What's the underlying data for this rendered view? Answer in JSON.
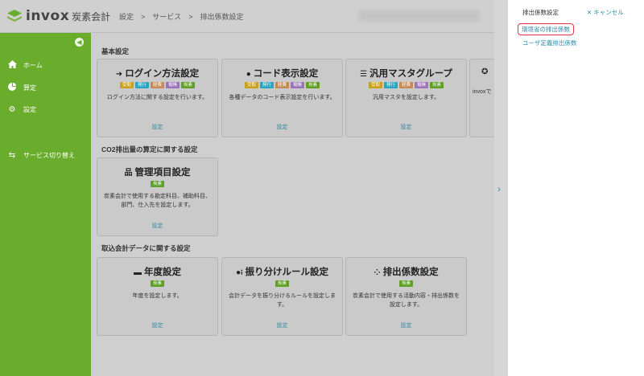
{
  "app": {
    "logo": "invox",
    "logo_sub": "炭素会計",
    "breadcrumb": "設定　>　サービス　>　排出係数設定"
  },
  "sidebar": {
    "items": [
      {
        "label": "ホーム",
        "icon": "home-icon"
      },
      {
        "label": "算定",
        "icon": "pie-chart-icon"
      },
      {
        "label": "設定",
        "icon": "gear-icon"
      },
      {
        "label": "サービス切り替え",
        "icon": "switch-icon"
      }
    ]
  },
  "sections": [
    {
      "title": "基本設定"
    },
    {
      "title": "CO2排出量の算定に関する設定"
    },
    {
      "title": "取込会計データに関する設定"
    }
  ],
  "cards": [
    {
      "icon": "sign-in-icon",
      "title": "ログイン方法設定",
      "tags": [
        "受取",
        "発行",
        "経費",
        "電帳",
        "炭素"
      ],
      "desc": "ログイン方法に関する設定を行います。",
      "link": "設定"
    },
    {
      "icon": "abc-icon",
      "title": "コード表示設定",
      "tags": [
        "受取",
        "発行",
        "経費",
        "電帳",
        "炭素"
      ],
      "desc": "各種データのコード表示設定を行います。",
      "link": "設定"
    },
    {
      "icon": "list-icon",
      "title": "汎用マスタグループ",
      "tags": [
        "受取",
        "発行",
        "経費",
        "電帳",
        "炭素"
      ],
      "desc": "汎用マスタを設定します。",
      "link": "設定"
    },
    {
      "icon": "star-icon",
      "title": "",
      "tags": [],
      "desc": "invoxで",
      "link": ""
    },
    {
      "icon": "sitemap-icon",
      "title": "管理項目設定",
      "tags": [
        "炭素"
      ],
      "desc": "炭素会計で使用する勘定科目、補助科目、部門、仕入先を設定します。",
      "link": "設定"
    },
    {
      "icon": "calendar-icon",
      "title": "年度設定",
      "tags": [
        "炭素"
      ],
      "desc": "年度を設定します。",
      "link": "設定"
    },
    {
      "icon": "rule-icon",
      "title": "振り分けルール設定",
      "tags": [
        "炭素"
      ],
      "desc": "会計データを振り分けるルールを設定します。",
      "link": "設定"
    },
    {
      "icon": "factor-icon",
      "title": "排出係数設定",
      "tags": [
        "炭素"
      ],
      "desc": "炭素会計で使用する活動内容・排出係数を設定します。",
      "link": "設定"
    }
  ],
  "tag_colors": {
    "受取": "#c8a21e",
    "発行": "#2ba4bf",
    "経費": "#c48a54",
    "電帳": "#9a74b8",
    "炭素": "#5f9f24"
  },
  "panel": {
    "title": "排出係数設定",
    "cancel_label": "キャンセル",
    "items": [
      {
        "label": "環境省の排出係数"
      },
      {
        "label": "ユーザ定義排出係数"
      }
    ]
  }
}
